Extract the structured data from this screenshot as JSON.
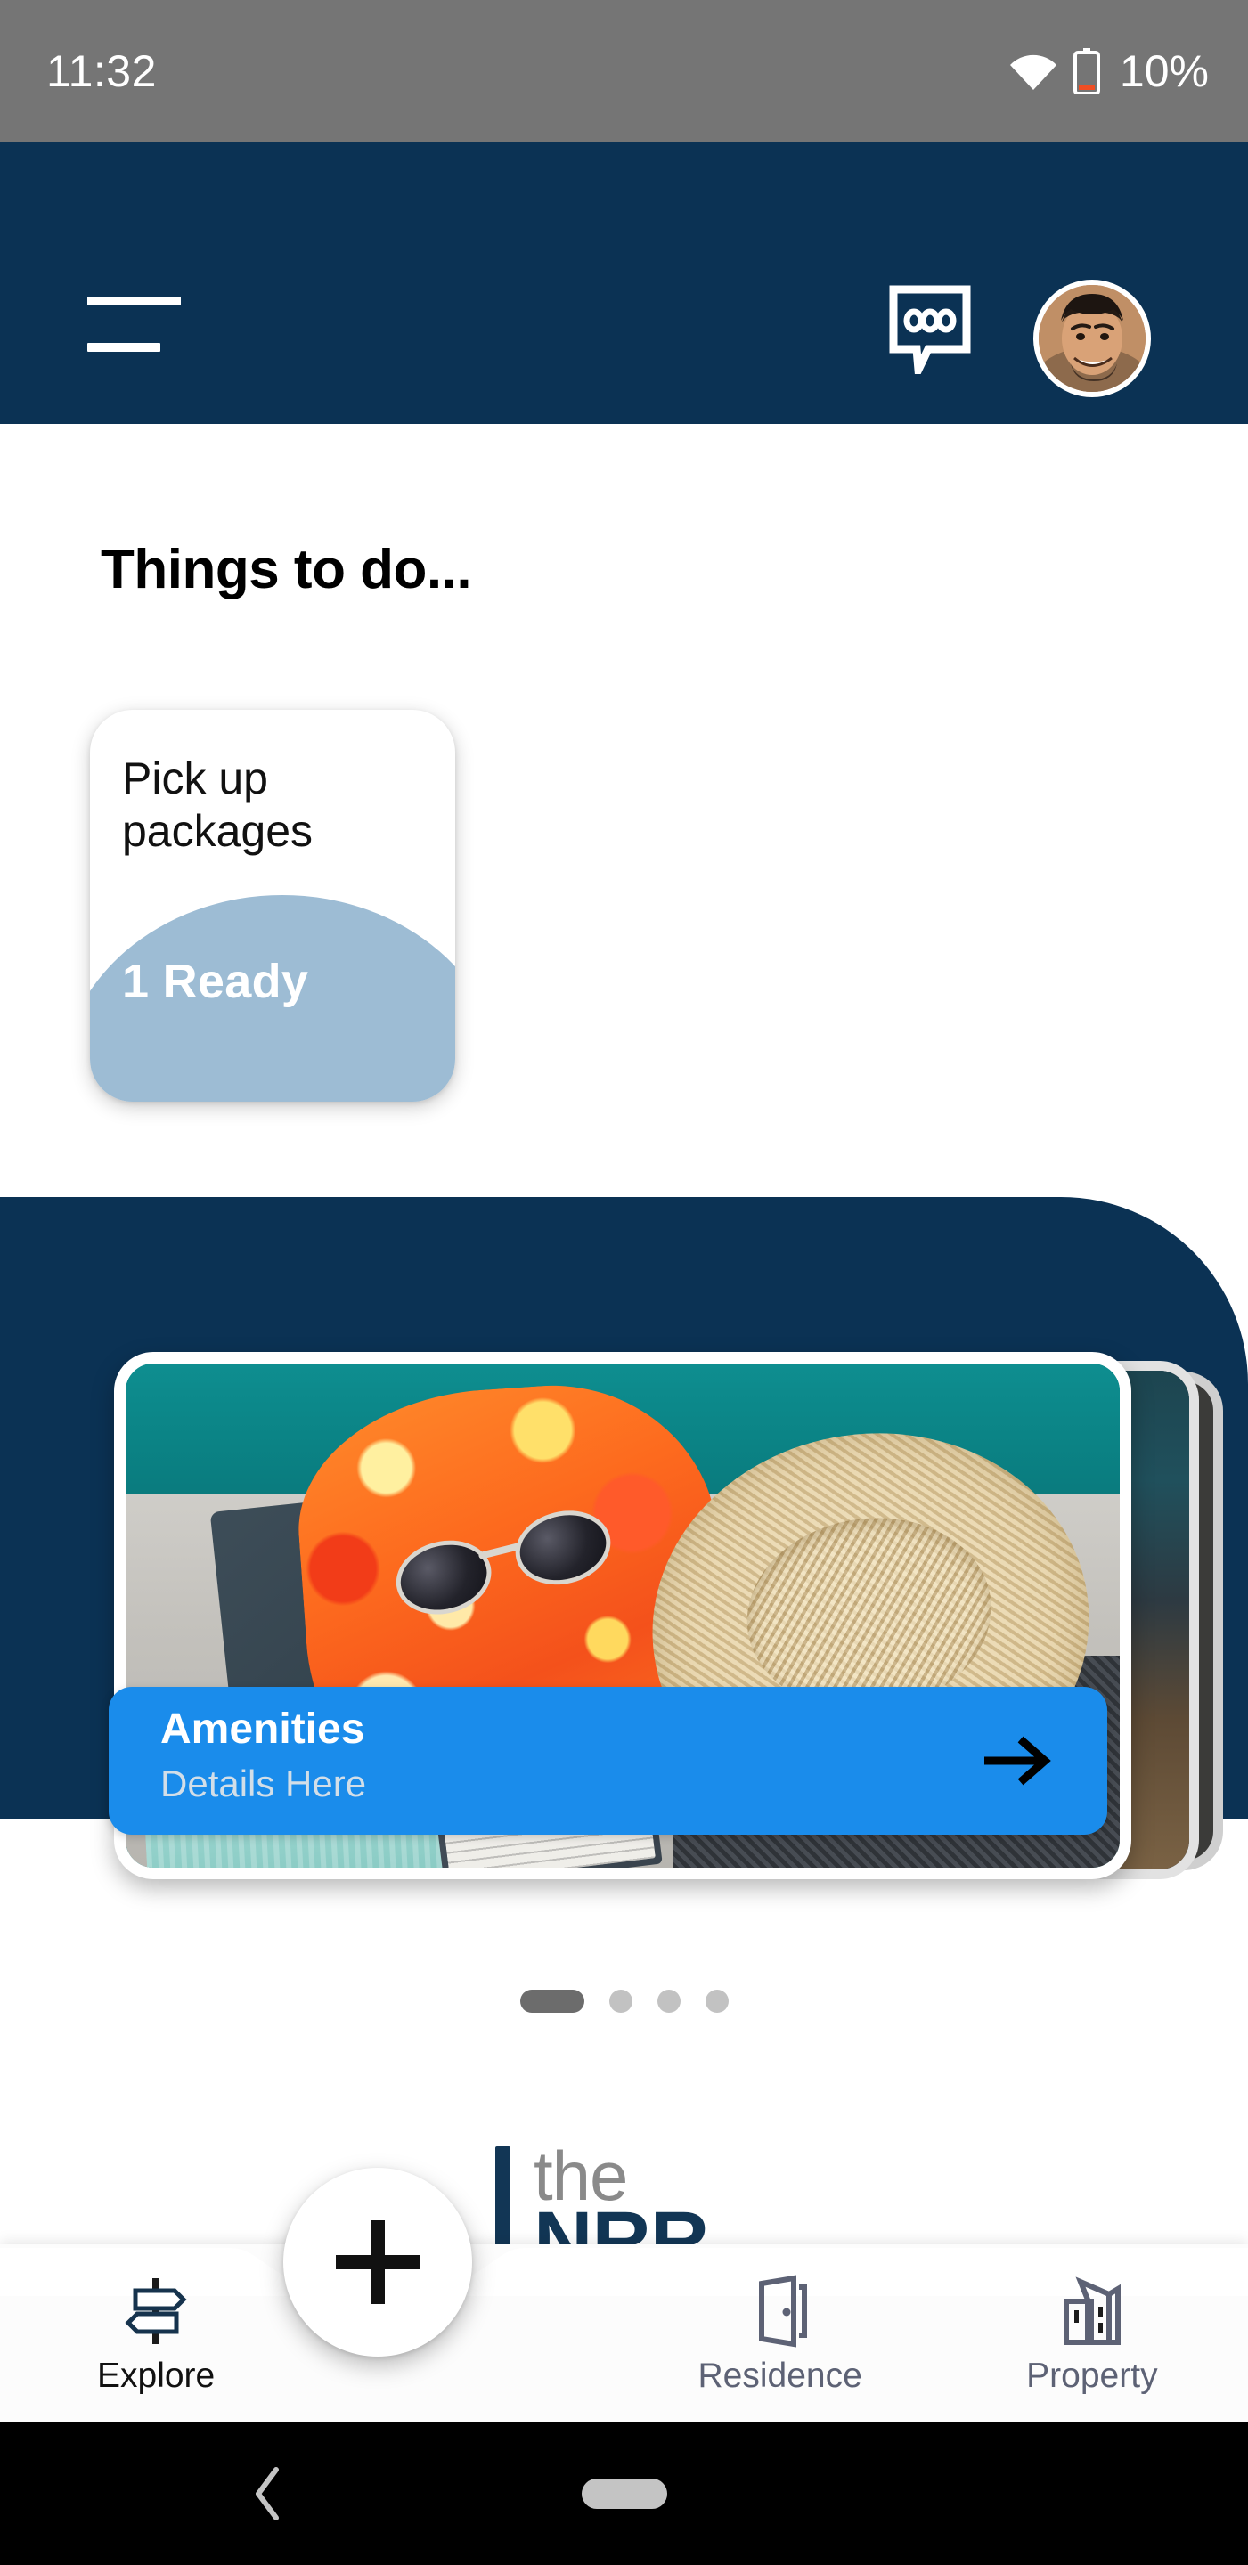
{
  "statusbar": {
    "time": "11:32",
    "battery_text": "10%",
    "wifi_icon": "wifi-icon",
    "battery_icon": "battery-low-icon",
    "background_color": "#757575",
    "text_color": "#ffffff",
    "battery_level_color": "#ef4e23"
  },
  "header": {
    "background_color": "#0b3254",
    "menu_icon": "hamburger-menu-icon",
    "chat_icon": "chat-bubble-icon",
    "avatar_icon": "user-avatar"
  },
  "main": {
    "section_title": "Things to do...",
    "todo_card": {
      "title": "Pick up packages",
      "badge": "1 Ready",
      "badge_bg_color": "#9dbcd4",
      "card_bg_color": "#ffffff"
    }
  },
  "carousel": {
    "section_bg_color": "#0b3254",
    "cards": [
      {
        "title": "Amenities",
        "subtitle": "Details Here",
        "banner_color": "#1a8ceb",
        "arrow_icon": "arrow-right-icon",
        "image_alt": "beach-items-photo"
      }
    ],
    "dots": [
      {
        "active": true
      },
      {
        "active": false
      },
      {
        "active": false
      },
      {
        "active": false
      }
    ],
    "dot_active_color": "#6c6c6c",
    "dot_inactive_color": "#c2c2c2"
  },
  "brand": {
    "line1": "the",
    "line2": "NRR",
    "bar_color": "#123655",
    "line1_color": "#8a8a8a",
    "line2_color": "#123655"
  },
  "bottom_nav": {
    "add_button": {
      "icon": "plus-icon",
      "label": "+"
    },
    "items": [
      {
        "label": "Explore",
        "icon": "signpost-icon",
        "active": true
      },
      {
        "label": "Residence",
        "icon": "open-door-icon",
        "active": false
      },
      {
        "label": "Property",
        "icon": "buildings-icon",
        "active": false
      }
    ],
    "background_color": "#fcfcfc",
    "active_label_color": "#111111",
    "inactive_label_color": "#5d6275"
  },
  "system_nav": {
    "back_icon": "back-chevron-icon",
    "home_icon": "home-pill-icon",
    "background_color": "#000000"
  }
}
